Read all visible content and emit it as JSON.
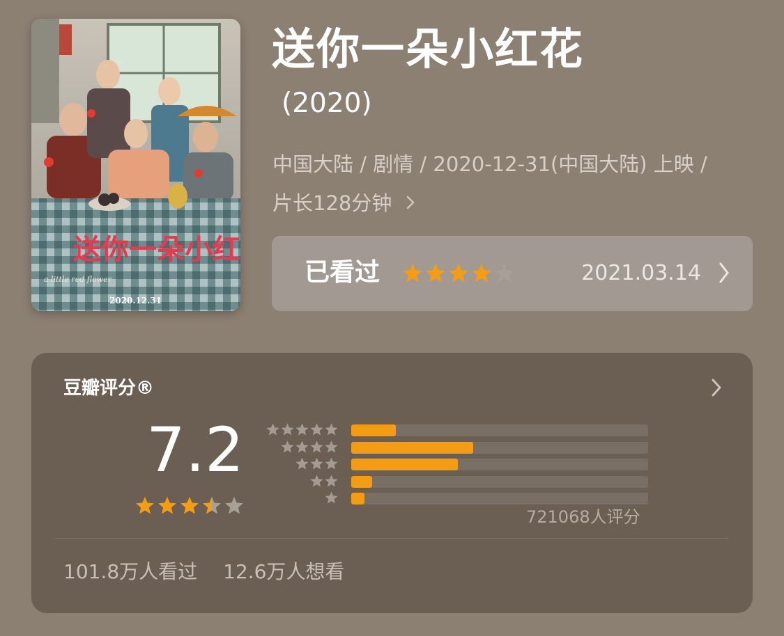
{
  "movie": {
    "title": "送你一朵小红花",
    "year": "(2020)",
    "meta_line1": "中国大陆 / 剧情 / 2020-12-31(中国大陆) 上映 /",
    "meta_line2": "片长128分钟"
  },
  "poster": {
    "title_art": "送你一朵小红花",
    "subtitle_art": "a little red flower",
    "date_text": "2020.12.31"
  },
  "watched": {
    "label": "已看过",
    "stars": 4,
    "max_stars": 5,
    "date": "2021.03.14"
  },
  "rating": {
    "title": "豆瓣评分®",
    "score": "7.2",
    "score_stars": 3.5,
    "distribution": [
      {
        "stars": 5,
        "fraction": 0.15
      },
      {
        "stars": 4,
        "fraction": 0.41
      },
      {
        "stars": 3,
        "fraction": 0.36
      },
      {
        "stars": 2,
        "fraction": 0.07
      },
      {
        "stars": 1,
        "fraction": 0.045
      }
    ],
    "count_text": "721068人评分",
    "watched_text": "101.8万人看过",
    "want_text": "12.6万人想看"
  },
  "colors": {
    "background": "#8c8073",
    "card": "#6b5f53",
    "star_active": "#f59d12",
    "star_inactive": "#a89f96",
    "bar_fill": "#f59d12"
  }
}
